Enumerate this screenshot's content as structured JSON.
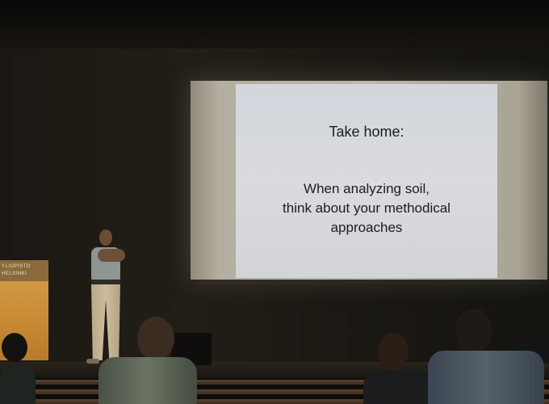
{
  "slide": {
    "title": "Take home:",
    "body_lines": [
      "When analyzing soil,",
      "think about your methodical",
      "approaches"
    ]
  },
  "lectern_sign": {
    "line1": "YLIOPISTO",
    "line2": "HELSINKI"
  },
  "colors": {
    "slide_background": "#d6d8dd",
    "slide_text": "#1c1c1c",
    "lectern": "#c98a34",
    "auditorium_dark": "#15120e"
  }
}
